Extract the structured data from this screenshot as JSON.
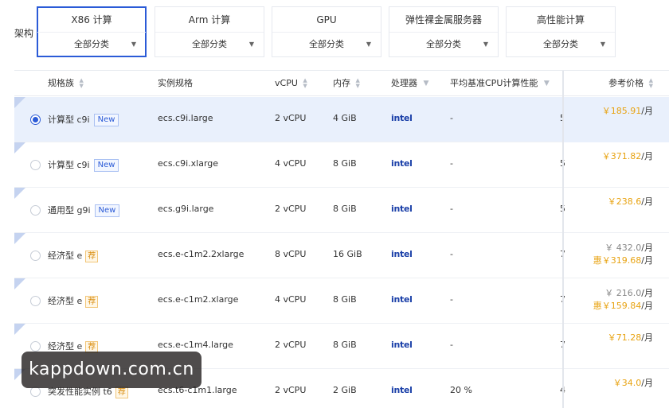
{
  "arch": {
    "label": "架构",
    "cards": [
      {
        "title": "X86 计算",
        "select": "全部分类",
        "active": true
      },
      {
        "title": "Arm 计算",
        "select": "全部分类"
      },
      {
        "title": "GPU",
        "select": "全部分类"
      },
      {
        "title": "弹性裸金属服务器",
        "select": "全部分类"
      },
      {
        "title": "高性能计算",
        "select": "全部分类"
      }
    ]
  },
  "table": {
    "headers": {
      "family": "规格族",
      "spec": "实例规格",
      "vcpu": "vCPU",
      "memory": "内存",
      "processor": "处理器",
      "baseline": "平均基准CPU计算性能",
      "price": "参考价格"
    },
    "rows": [
      {
        "family": "计算型 c9i",
        "badge": "New",
        "spec": "ecs.c9i.large",
        "vcpu": "2 vCPU",
        "memory": "4 GiB",
        "processor": "intel",
        "baseline": "-",
        "next": "5",
        "price": "￥185.91",
        "unit": "/月",
        "selected": true
      },
      {
        "family": "计算型 c9i",
        "badge": "New",
        "spec": "ecs.c9i.xlarge",
        "vcpu": "4 vCPU",
        "memory": "8 GiB",
        "processor": "intel",
        "baseline": "-",
        "next": "5",
        "price": "￥371.82",
        "unit": "/月"
      },
      {
        "family": "通用型 g9i",
        "badge": "New",
        "spec": "ecs.g9i.large",
        "vcpu": "2 vCPU",
        "memory": "8 GiB",
        "processor": "intel",
        "baseline": "-",
        "next": "5",
        "price": "￥238.6",
        "unit": "/月"
      },
      {
        "family": "经济型 e",
        "badge": "荐",
        "spec": "ecs.e-c1m2.2xlarge",
        "vcpu": "8 vCPU",
        "memory": "16 GiB",
        "processor": "intel",
        "baseline": "-",
        "next": "7",
        "price_orig": "￥ 432.0",
        "price_orig_unit": "/月",
        "price_disc_label": "惠",
        "price": "￥319.68",
        "unit": "/月"
      },
      {
        "family": "经济型 e",
        "badge": "荐",
        "spec": "ecs.e-c1m2.xlarge",
        "vcpu": "4 vCPU",
        "memory": "8 GiB",
        "processor": "intel",
        "baseline": "-",
        "next": "7",
        "price_orig": "￥ 216.0",
        "price_orig_unit": "/月",
        "price_disc_label": "惠",
        "price": "￥159.84",
        "unit": "/月"
      },
      {
        "family": "经济型 e",
        "badge": "荐",
        "spec": "ecs.e-c1m4.large",
        "vcpu": "2 vCPU",
        "memory": "8 GiB",
        "processor": "intel",
        "baseline": "-",
        "next": "7",
        "price": "￥71.28",
        "unit": "/月"
      },
      {
        "family": "突发性能实例 t6",
        "badge": "荐",
        "spec": "ecs.t6-c1m1.large",
        "vcpu": "2 vCPU",
        "memory": "2 GiB",
        "processor": "intel",
        "baseline": "20 %",
        "next": "4",
        "price": "￥34.0",
        "unit": "/月"
      }
    ]
  },
  "watermark": "kappdown.com.cn",
  "colors": {
    "accent": "#2b5bd7",
    "price": "#e8a312",
    "selected_row": "#e9f0fc"
  }
}
